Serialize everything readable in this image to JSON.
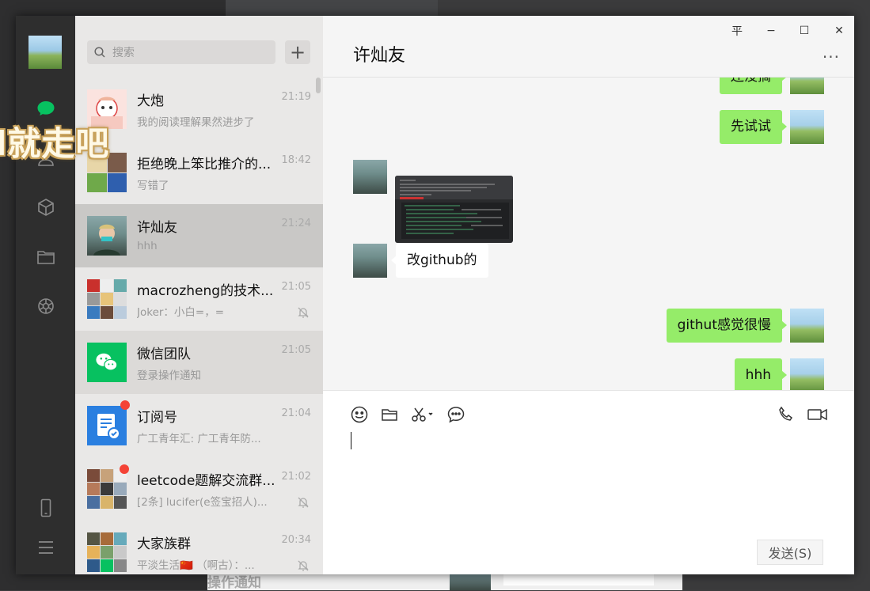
{
  "overlay": {
    "text": "l就走吧"
  },
  "background": {
    "bottom_text": "操作通知"
  },
  "search": {
    "placeholder": "搜索",
    "add_label": "+"
  },
  "window_controls": {
    "pin": "平",
    "minimize": "−",
    "maximize": "☐",
    "close": "✕"
  },
  "chat_list": [
    {
      "name": "大炮",
      "time": "21:19",
      "preview": "我的阅读理解果然进步了",
      "muted": false,
      "unread_dot": false
    },
    {
      "name": "拒绝晚上笨比推介的...",
      "time": "18:42",
      "preview": "写错了",
      "muted": false,
      "unread_dot": false
    },
    {
      "name": "许灿友",
      "time": "21:24",
      "preview": "hhh",
      "muted": false,
      "unread_dot": false
    },
    {
      "name": "macrozheng的技术...",
      "time": "21:05",
      "preview": "Joker：小白=，=",
      "muted": true,
      "unread_dot": false
    },
    {
      "name": "微信团队",
      "time": "21:05",
      "preview": "登录操作通知",
      "muted": false,
      "unread_dot": false
    },
    {
      "name": "订阅号",
      "time": "21:04",
      "preview": "广工青年汇: 广工青年防...",
      "muted": false,
      "unread_dot": true
    },
    {
      "name": "leetcode题解交流群...",
      "time": "21:02",
      "preview": "[2条] lucifer(e签宝招人)...",
      "muted": true,
      "unread_dot": true
    },
    {
      "name": "大家族群",
      "time": "20:34",
      "preview": "平淡生活🇨🇳 （啊古）：...",
      "muted": true,
      "unread_dot": false
    }
  ],
  "conversation": {
    "title": "许灿友",
    "more": "···",
    "messages": [
      {
        "from": "me",
        "text": "还没搞"
      },
      {
        "from": "me",
        "text": "先试试"
      },
      {
        "from": "peer",
        "type": "image",
        "text": ""
      },
      {
        "from": "peer",
        "text": "改github的"
      },
      {
        "from": "me",
        "text": "githut感觉很慢"
      },
      {
        "from": "me",
        "text": "hhh"
      }
    ]
  },
  "input": {
    "send_label": "发送(S)"
  },
  "colors": {
    "my_bubble": "#95ec69",
    "peer_bubble": "#ffffff",
    "nav_active": "#07c160",
    "unread": "#f44336"
  }
}
